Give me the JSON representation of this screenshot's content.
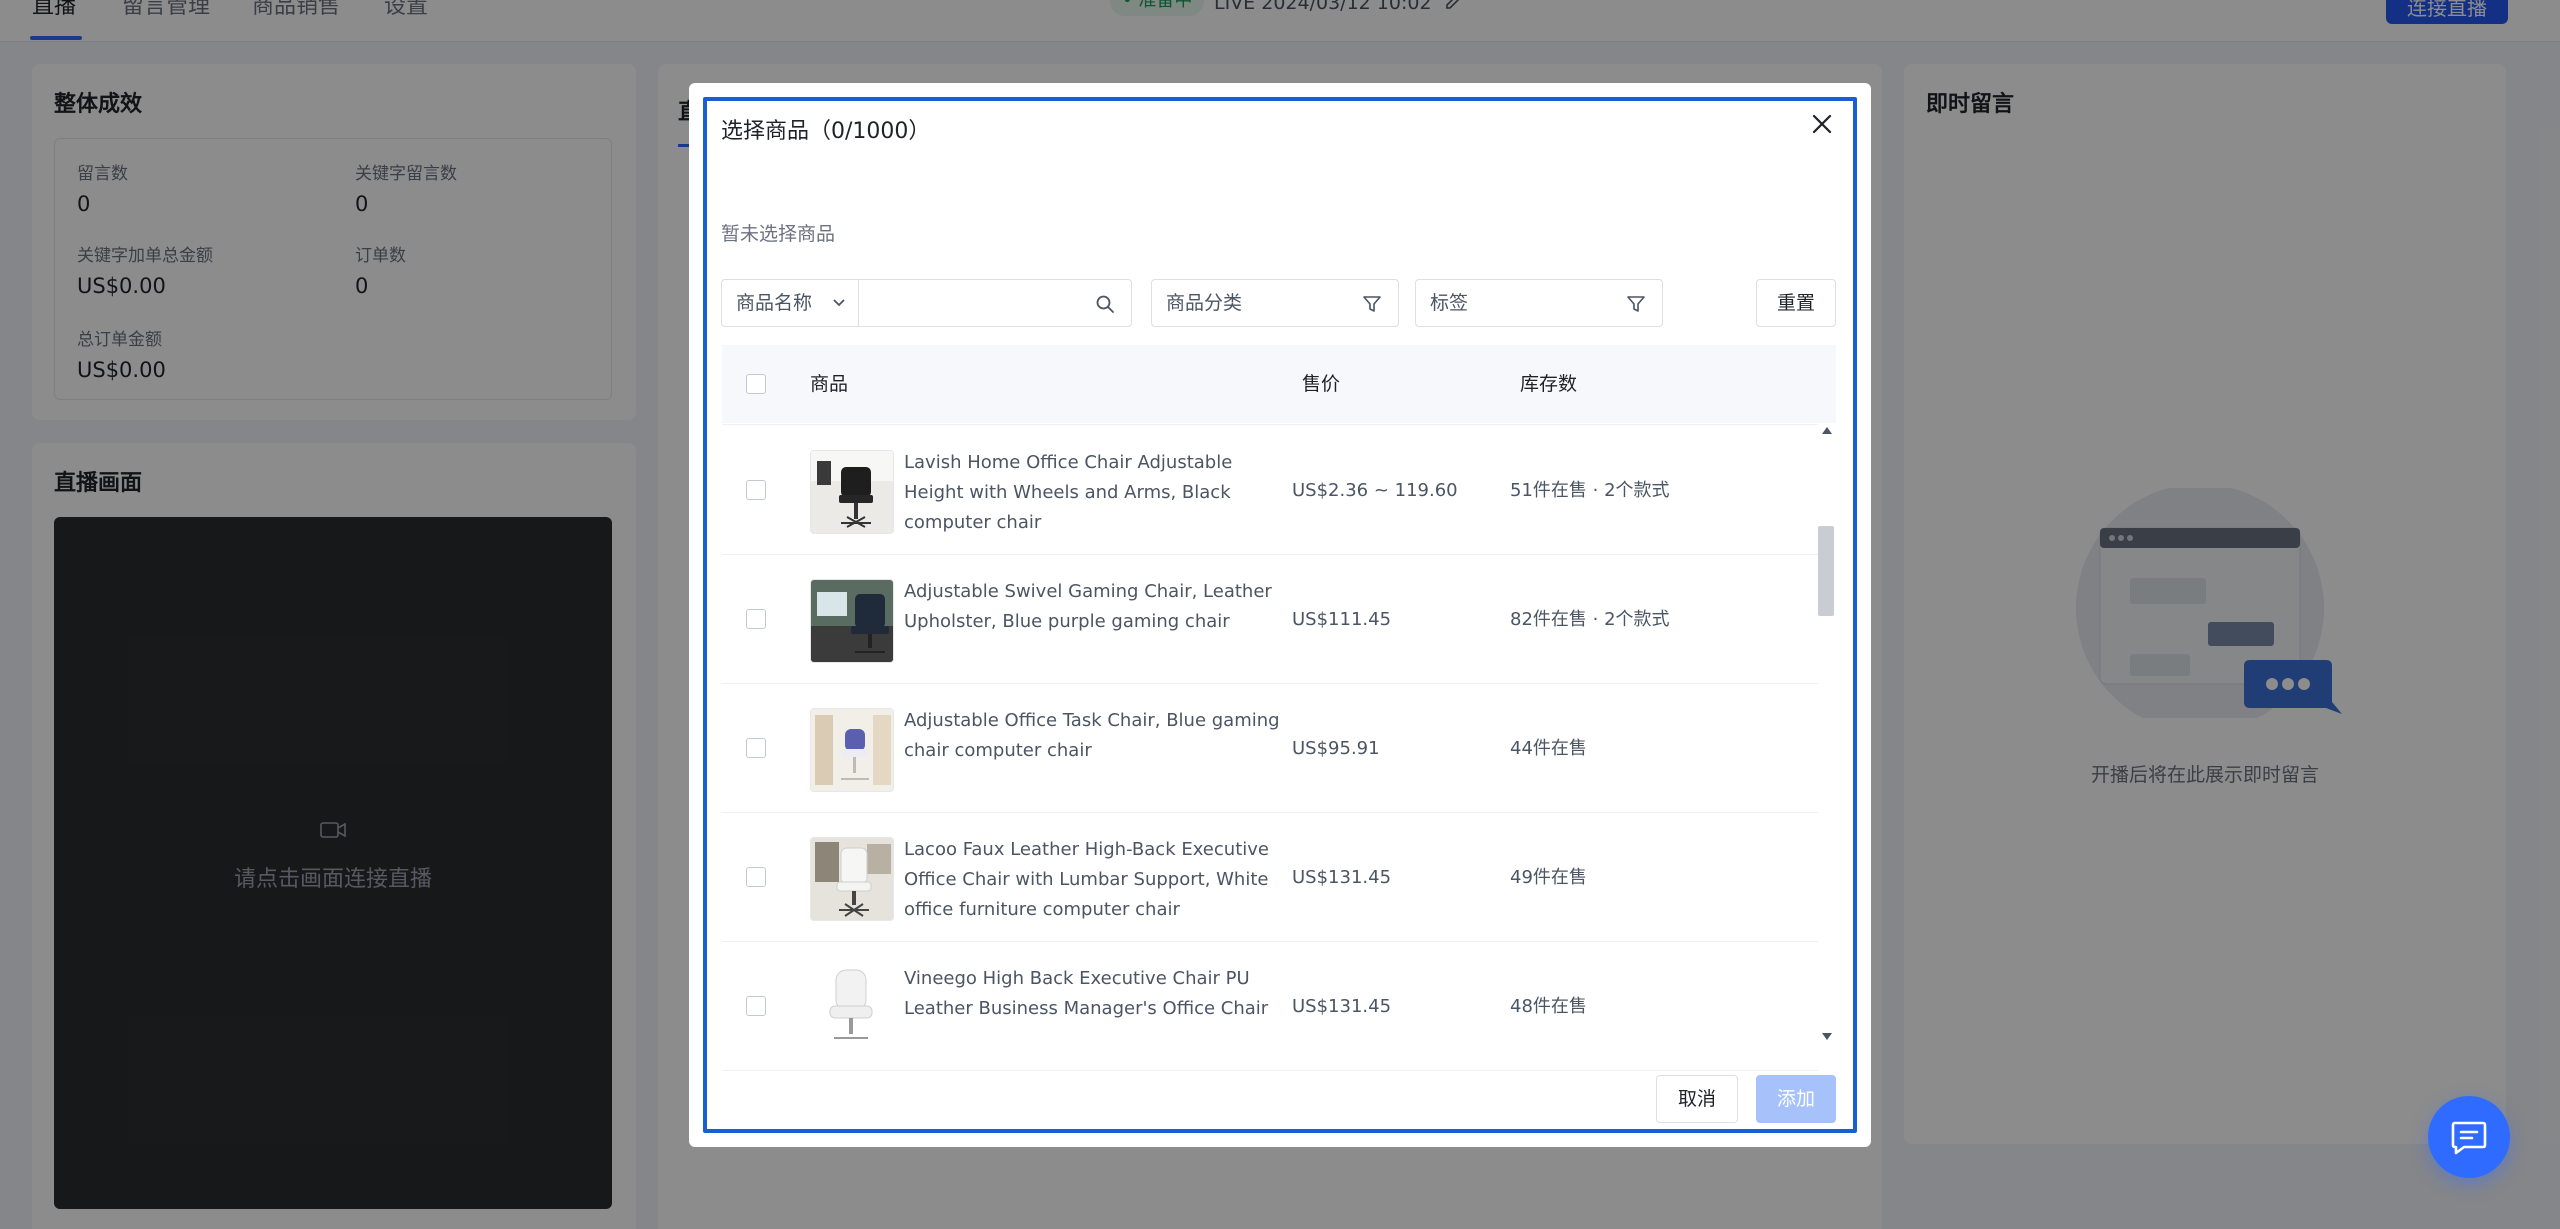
{
  "topnav": {
    "tabs": [
      "直播",
      "留言管理",
      "商品销售",
      "设置"
    ],
    "status_badge": "• 准备中",
    "live_title": "LIVE 2024/03/12 10:02",
    "connect_label": "连接直播"
  },
  "overall": {
    "title": "整体成效",
    "stats": [
      {
        "label": "留言数",
        "value": "0"
      },
      {
        "label": "关键字留言数",
        "value": "0"
      },
      {
        "label": "关键字加单总金额",
        "value": "US$0.00"
      },
      {
        "label": "订单数",
        "value": "0"
      },
      {
        "label": "总订单金额",
        "value": "US$0.00"
      }
    ]
  },
  "live_screen": {
    "title": "直播画面",
    "hint": "请点击画面连接直播"
  },
  "middle_panel": {
    "tab_initial": "直"
  },
  "instant_comments": {
    "title": "即时留言",
    "empty_text": "开播后将在此展示即时留言"
  },
  "modal": {
    "title": "选择商品（0/1000）",
    "empty_selection": "暂未选择商品",
    "filters": {
      "search_field_label": "商品名称",
      "category_label": "商品分类",
      "tag_label": "标签",
      "reset_label": "重置"
    },
    "table": {
      "headers": {
        "product": "商品",
        "price": "售价",
        "stock": "库存数"
      },
      "rows": [
        {
          "name": "Lavish Home Office Chair Adjustable Height with Wheels and Arms, Black computer chair",
          "price": "US$2.36 ~ 119.60",
          "stock": "51件在售 · 2个款式"
        },
        {
          "name": "Adjustable Swivel Gaming Chair, Leather Upholster, Blue purple gaming chair",
          "price": "US$111.45",
          "stock": "82件在售 · 2个款式"
        },
        {
          "name": "Adjustable Office Task Chair, Blue gaming chair computer chair",
          "price": "US$95.91",
          "stock": "44件在售"
        },
        {
          "name": "Lacoo Faux Leather High-Back Executive Office Chair with Lumbar Support, White office furniture computer chair",
          "price": "US$131.45",
          "stock": "49件在售"
        },
        {
          "name": "Vineego High Back Executive Chair PU Leather Business Manager's Office Chair",
          "price": "US$131.45",
          "stock": "48件在售"
        }
      ]
    },
    "cancel_label": "取消",
    "add_label": "添加"
  },
  "colors": {
    "primary": "#2f6bff",
    "modal_frame": "#1a5fd1",
    "add_disabled": "#a7c1fb"
  }
}
